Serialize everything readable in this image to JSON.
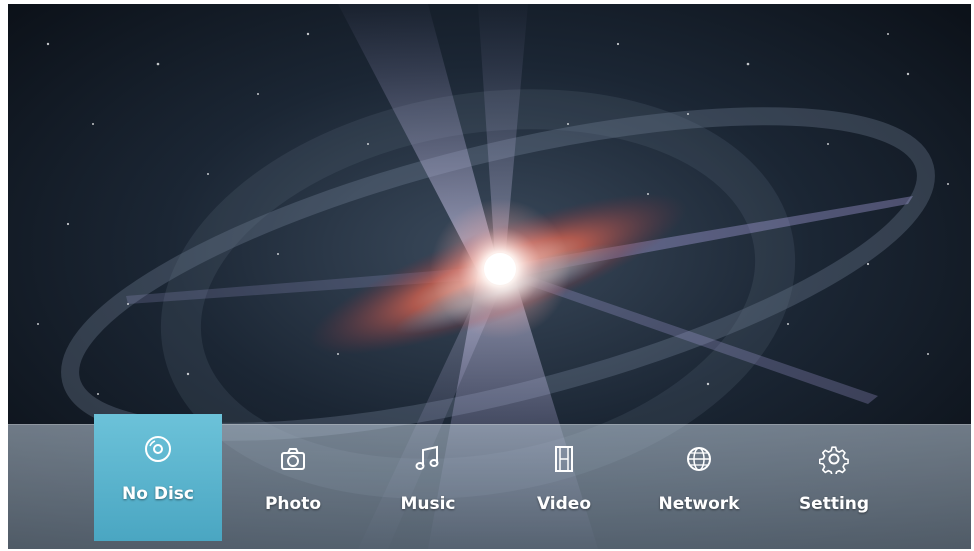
{
  "colors": {
    "selected_bg": "#5bb6ce",
    "bar_bg": "#a9bacb",
    "label": "#ffffff"
  },
  "menu": {
    "selected_index": 0,
    "items": [
      {
        "label": "No Disc",
        "icon": "disc-icon"
      },
      {
        "label": "Photo",
        "icon": "camera-icon"
      },
      {
        "label": "Music",
        "icon": "music-note-icon"
      },
      {
        "label": "Video",
        "icon": "film-icon"
      },
      {
        "label": "Network",
        "icon": "globe-icon"
      },
      {
        "label": "Setting",
        "icon": "gear-icon"
      }
    ]
  }
}
